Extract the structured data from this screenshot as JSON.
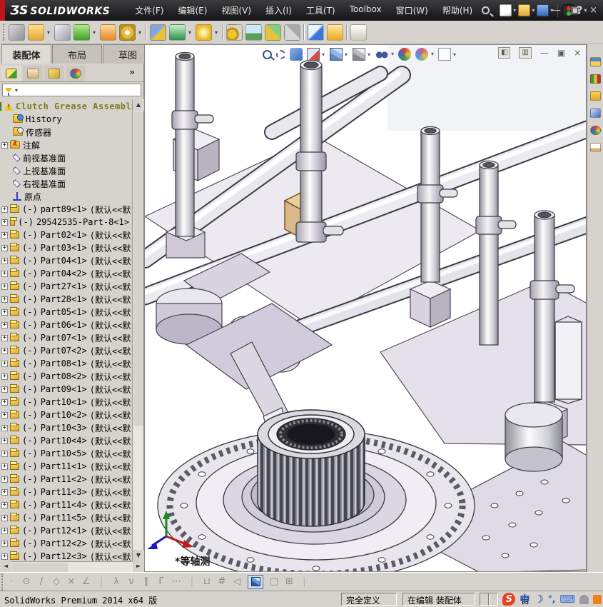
{
  "titlebar": {
    "logo_prefix": "ƷS",
    "logo_text": "SOLIDWORKS",
    "menus": [
      "文件(F)",
      "编辑(E)",
      "视图(V)",
      "插入(I)",
      "工具(T)",
      "Toolbox",
      "窗口(W)",
      "帮助(H)"
    ],
    "help_glyph": "?",
    "window": {
      "minimize": "—",
      "restore": "▣",
      "close": "×"
    }
  },
  "ribbon": {
    "icons": [
      {
        "name": "insert-components-icon",
        "cls": "ic-gray"
      },
      {
        "name": "open-part-icon",
        "cls": "ic-folder dd"
      },
      {
        "name": "mate-icon",
        "cls": "ic-clip"
      },
      {
        "name": "linear-component-pattern-icon",
        "cls": "ic-green dd"
      },
      {
        "name": "smart-fasteners-icon",
        "cls": "ic-orange"
      },
      {
        "name": "rotate-component-icon",
        "cls": "ic-goldring dd"
      },
      {
        "name": "separator",
        "cls": "sep"
      },
      {
        "name": "move-component-icon",
        "cls": "ic-bluegold"
      },
      {
        "name": "show-hidden-components-icon",
        "cls": "ic-greenbox dd"
      },
      {
        "name": "assembly-features-icon",
        "cls": "ic-star dd"
      },
      {
        "name": "separator",
        "cls": "sep"
      },
      {
        "name": "motion-study-icon",
        "cls": "ic-gears"
      },
      {
        "name": "component-preview-window-icon",
        "cls": "ic-screen"
      },
      {
        "name": "exploded-view-icon",
        "cls": "ic-steps"
      },
      {
        "name": "explode-line-sketch-icon",
        "cls": "ic-graysteps"
      },
      {
        "name": "separator",
        "cls": "sep"
      },
      {
        "name": "instant3d-icon",
        "cls": "ic-blade"
      },
      {
        "name": "interference-detection-icon",
        "cls": "ic-warn"
      },
      {
        "name": "separator",
        "cls": "sep"
      },
      {
        "name": "appearance-frame-icon",
        "cls": "ic-frame"
      }
    ]
  },
  "tabs": {
    "items": [
      {
        "label": "装配体",
        "state": "active"
      },
      {
        "label": "布局",
        "state": ""
      },
      {
        "label": "草图",
        "state": ""
      }
    ]
  },
  "panel": {
    "manager_tabs": [
      {
        "name": "featuremanager-tab-icon",
        "cls": "mi-feat",
        "state": "active"
      },
      {
        "name": "propertymanager-tab-icon",
        "cls": "mi-prop",
        "state": ""
      },
      {
        "name": "configurationmanager-tab-icon",
        "cls": "mi-cfg",
        "state": ""
      },
      {
        "name": "displaymanager-tab-icon",
        "cls": "mi-disp",
        "state": ""
      }
    ],
    "overflow_glyph": "»"
  },
  "tree": {
    "root": "Clutch Grease Assembly",
    "items": [
      "History",
      "传感器",
      "注解",
      "前视基准面",
      "上视基准面",
      "右视基准面",
      "原点"
    ],
    "default_suffix": "(默认<<默",
    "parts": [
      {
        "prefix": "(-)",
        "name": "part89<1>",
        "suffix": "(默认<<默"
      },
      {
        "prefix": "(-)",
        "name": "29542535-Part-8<1>",
        "suffix": ""
      },
      {
        "prefix": "(-)",
        "name": "Part02<1>",
        "suffix": "(默认<<默"
      },
      {
        "prefix": "(-)",
        "name": "Part03<1>",
        "suffix": "(默认<<默"
      },
      {
        "prefix": "(-)",
        "name": "Part04<1>",
        "suffix": "(默认<<默"
      },
      {
        "prefix": "(-)",
        "name": "Part04<2>",
        "suffix": "(默认<<默"
      },
      {
        "prefix": "(-)",
        "name": "Part27<1>",
        "suffix": "(默认<<默"
      },
      {
        "prefix": "(-)",
        "name": "Part28<1>",
        "suffix": "(默认<<默"
      },
      {
        "prefix": "(-)",
        "name": "Part05<1>",
        "suffix": "(默认<<默"
      },
      {
        "prefix": "(-)",
        "name": "Part06<1>",
        "suffix": "(默认<<默"
      },
      {
        "prefix": "(-)",
        "name": "Part07<1>",
        "suffix": "(默认<<默"
      },
      {
        "prefix": "(-)",
        "name": "Part07<2>",
        "suffix": "(默认<<默"
      },
      {
        "prefix": "(-)",
        "name": "Part08<1>",
        "suffix": "(默认<<默"
      },
      {
        "prefix": "(-)",
        "name": "Part08<2>",
        "suffix": "(默认<<默"
      },
      {
        "prefix": "(-)",
        "name": "Part09<1>",
        "suffix": "(默认<<默"
      },
      {
        "prefix": "(-)",
        "name": "Part10<1>",
        "suffix": "(默认<<默"
      },
      {
        "prefix": "(-)",
        "name": "Part10<2>",
        "suffix": "(默认<<默"
      },
      {
        "prefix": "(-)",
        "name": "Part10<3>",
        "suffix": "(默认<<默"
      },
      {
        "prefix": "(-)",
        "name": "Part10<4>",
        "suffix": "(默认<<默"
      },
      {
        "prefix": "(-)",
        "name": "Part10<5>",
        "suffix": "(默认<<默"
      },
      {
        "prefix": "(-)",
        "name": "Part11<1>",
        "suffix": "(默认<<默"
      },
      {
        "prefix": "(-)",
        "name": "Part11<2>",
        "suffix": "(默认<<默"
      },
      {
        "prefix": "(-)",
        "name": "Part11<3>",
        "suffix": "(默认<<默"
      },
      {
        "prefix": "(-)",
        "name": "Part11<4>",
        "suffix": "(默认<<默"
      },
      {
        "prefix": "(-)",
        "name": "Part11<5>",
        "suffix": "(默认<<默"
      },
      {
        "prefix": "(-)",
        "name": "Part12<1>",
        "suffix": "(默认<<默"
      },
      {
        "prefix": "(-)",
        "name": "Part12<2>",
        "suffix": "(默认<<默"
      },
      {
        "prefix": "(-)",
        "name": "Part12<3>",
        "suffix": "(默认<<默"
      }
    ]
  },
  "headsup": {
    "icons": [
      {
        "name": "zoom-to-fit-icon",
        "cls": "hi-zoomfit"
      },
      {
        "name": "zoom-to-area-icon",
        "cls": "hi-zoomarea"
      },
      {
        "name": "previous-view-icon",
        "cls": "hi-prev"
      },
      {
        "name": "section-view-icon",
        "cls": "hi-section dd"
      },
      {
        "name": "view-orientation-icon",
        "cls": "hi-cube dd"
      },
      {
        "name": "display-style-icon",
        "cls": "hi-display dd"
      },
      {
        "name": "hide-show-items-icon",
        "cls": "hi-glasses dd"
      },
      {
        "name": "edit-appearance-icon",
        "cls": "hi-ball"
      },
      {
        "name": "apply-scene-icon",
        "cls": "hi-ball2 dd"
      },
      {
        "name": "view-settings-icon",
        "cls": "hi-page dd"
      }
    ]
  },
  "docwindow": {
    "pane_left": "◧",
    "pane_right": "▥",
    "minimize": "—",
    "restore": "▣",
    "close": "×"
  },
  "taskpane": {
    "icons": [
      {
        "name": "solidworks-resources-icon",
        "cls": "tp-home"
      },
      {
        "name": "design-library-icon",
        "cls": "tp-lib"
      },
      {
        "name": "file-explorer-icon",
        "cls": "tp-folder"
      },
      {
        "name": "view-palette-icon",
        "cls": "tp-palette"
      },
      {
        "name": "appearances-scenes-icon",
        "cls": "tp-ball"
      },
      {
        "name": "custom-properties-icon",
        "cls": "tp-props"
      }
    ]
  },
  "viewport": {
    "view_orientation_label": "*等轴测"
  },
  "bottom_toolbar": {
    "icons": [
      {
        "glyph": "·",
        "name": "sketch-point-icon",
        "cls": ""
      },
      {
        "glyph": "⊙",
        "name": "sketch-circle-icon",
        "cls": ""
      },
      {
        "glyph": "/",
        "name": "sketch-line-icon",
        "cls": ""
      },
      {
        "glyph": "◇",
        "name": "sketch-polygon-icon",
        "cls": ""
      },
      {
        "glyph": "×",
        "name": "trim-entities-icon",
        "cls": ""
      },
      {
        "glyph": "∠",
        "name": "sketch-chamfer-icon",
        "cls": ""
      },
      {
        "glyph": "|",
        "name": "separator",
        "cls": "sepg"
      },
      {
        "glyph": "λ",
        "name": "pierce-relation-icon",
        "cls": ""
      },
      {
        "glyph": "ν",
        "name": "merge-relation-icon",
        "cls": ""
      },
      {
        "glyph": "∥",
        "name": "parallel-relation-icon",
        "cls": ""
      },
      {
        "glyph": "Γ",
        "name": "perpendicular-relation-icon",
        "cls": ""
      },
      {
        "glyph": "⋯",
        "name": "smart-dimension-icon",
        "cls": ""
      },
      {
        "glyph": "|",
        "name": "separator",
        "cls": "sepg"
      },
      {
        "glyph": "⊔",
        "name": "measure-icon",
        "cls": ""
      },
      {
        "glyph": "#",
        "name": "grid-snap-icon",
        "cls": ""
      },
      {
        "glyph": "◁",
        "name": "angle-snap-icon",
        "cls": ""
      },
      {
        "glyph": "",
        "name": "isometric-view-button",
        "cls": "cube"
      },
      {
        "glyph": "□",
        "name": "single-viewport-icon",
        "cls": ""
      },
      {
        "glyph": "⊞",
        "name": "viewport-layout-icon",
        "cls": ""
      },
      {
        "glyph": "|",
        "name": "separator",
        "cls": "sepg"
      }
    ]
  },
  "statusbar": {
    "app_version": "SolidWorks Premium 2014 x64 版",
    "fully_defined": "完全定义",
    "editing_state": "在编辑 装配体",
    "ime_prefix": "自",
    "ime": {
      "s_logo": "S",
      "lang": "中",
      "moon": "☽",
      "punct": "°,",
      "keyboard": "⌨"
    }
  }
}
